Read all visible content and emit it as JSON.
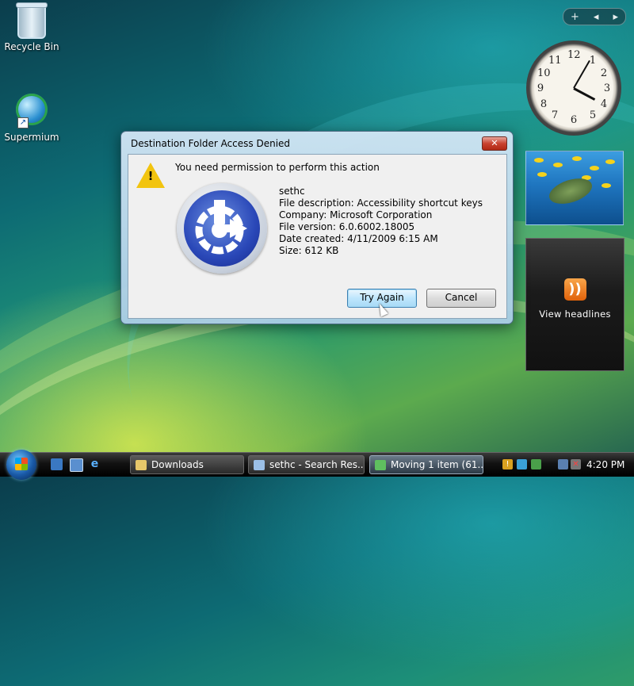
{
  "desktop": {
    "icons": [
      {
        "label": "Recycle Bin"
      },
      {
        "label": "Supermium"
      }
    ]
  },
  "sidebar": {
    "controls": {
      "add": "+",
      "prev": "◂",
      "next": "▸"
    },
    "clock": {
      "numbers": [
        "12",
        "1",
        "2",
        "3",
        "4",
        "5",
        "6",
        "7",
        "8",
        "9",
        "10",
        "11"
      ]
    },
    "feed_label": "View headlines"
  },
  "dialog": {
    "title": "Destination Folder Access Denied",
    "close_label": "✕",
    "message": "You need permission to perform this action",
    "file": {
      "name": "sethc",
      "description": "File description: Accessibility shortcut keys",
      "company": "Company: Microsoft Corporation",
      "version": "File version: 6.0.6002.18005",
      "date_created": "Date created: 4/11/2009 6:15 AM",
      "size": "Size: 612 KB"
    },
    "buttons": {
      "try_again": "Try Again",
      "cancel": "Cancel"
    }
  },
  "taskbar": {
    "tasks": [
      {
        "label": "Downloads"
      },
      {
        "label": "sethc - Search Res..."
      },
      {
        "label": "Moving 1 item (61..."
      }
    ],
    "clock": "4:20 PM"
  },
  "colors": {
    "warning": "#f2c40f",
    "close_button": "#c8422f",
    "accent_blue": "#2a48b8"
  }
}
